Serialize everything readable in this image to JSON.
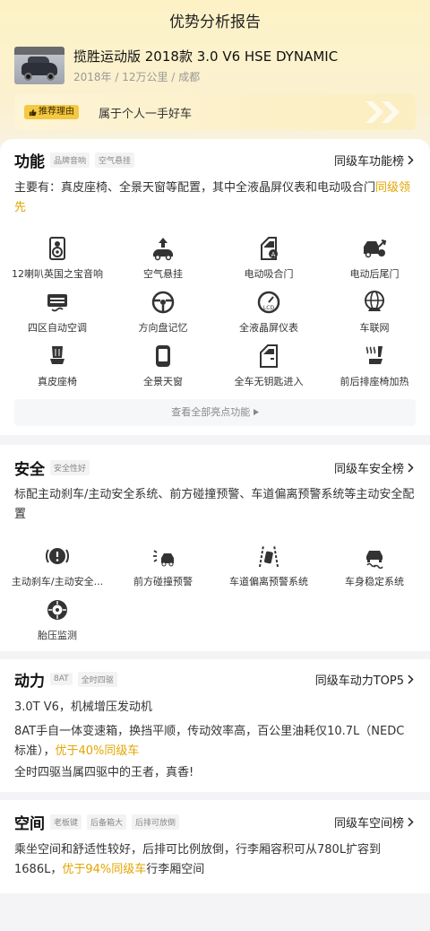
{
  "header": {
    "title": "优势分析报告"
  },
  "car": {
    "thumb_text": "揽胜运动版",
    "name": "揽胜运动版 2018款 3.0 V6 HSE DYNAMIC",
    "meta": "2018年 / 12万公里 / 成都"
  },
  "reason": {
    "tag": "推荐理由",
    "text": "属于个人一手好车"
  },
  "function": {
    "title": "功能",
    "tags": [
      "品牌音响",
      "空气悬挂"
    ],
    "link": "同级车功能榜",
    "desc_prefix": "主要有：真皮座椅、全景天窗等配置，其中全液晶屏仪表和电动吸合门",
    "desc_hl": "同级领先",
    "features": [
      {
        "label": "12喇叭英国之宝音响",
        "icon": "speaker-icon"
      },
      {
        "label": "空气悬挂",
        "icon": "air-suspension-icon"
      },
      {
        "label": "电动吸合门",
        "icon": "soft-close-door-icon"
      },
      {
        "label": "电动后尾门",
        "icon": "power-tailgate-icon"
      },
      {
        "label": "四区自动空调",
        "icon": "climate-control-icon"
      },
      {
        "label": "方向盘记忆",
        "icon": "steering-wheel-icon"
      },
      {
        "label": "全液晶屏仪表",
        "icon": "lcd-gauge-icon"
      },
      {
        "label": "车联网",
        "icon": "connected-car-icon"
      },
      {
        "label": "真皮座椅",
        "icon": "leather-seat-icon"
      },
      {
        "label": "全景天窗",
        "icon": "panoramic-roof-icon"
      },
      {
        "label": "全车无钥匙进入",
        "icon": "keyless-entry-icon"
      },
      {
        "label": "前后排座椅加热",
        "icon": "seat-heating-icon"
      }
    ],
    "more": "查看全部亮点功能"
  },
  "safety": {
    "title": "安全",
    "tags": [
      "安全性好"
    ],
    "link": "同级车安全榜",
    "desc": "标配主动刹车/主动安全系统、前方碰撞预警、车道偏离预警系统等主动安全配置",
    "features": [
      {
        "label": "主动刹车/主动安全...",
        "icon": "auto-brake-icon"
      },
      {
        "label": "前方碰撞预警",
        "icon": "collision-warning-icon"
      },
      {
        "label": "车道偏离预警系统",
        "icon": "lane-departure-icon"
      },
      {
        "label": "车身稳定系统",
        "icon": "stability-control-icon"
      },
      {
        "label": "胎压监测",
        "icon": "tire-pressure-icon"
      }
    ]
  },
  "power": {
    "title": "动力",
    "tags": [
      "8AT",
      "全时四驱"
    ],
    "link": "同级车动力TOP5",
    "line1": "3.0T V6，机械增压发动机",
    "line2_prefix": "8AT手自一体变速箱，换挡平顺，传动效率高，百公里油耗仅10.7L（NEDC标准），",
    "line2_hl": "优于40%同级车",
    "line3": "全时四驱当属四驱中的王者，真香!"
  },
  "space": {
    "title": "空间",
    "tags": [
      "老板键",
      "后备箱大",
      "后排可放倒"
    ],
    "link": "同级车空间榜",
    "desc_prefix": "乘坐空间和舒适性较好，后排可比例放倒，行李厢容积可从780L扩容到1686L，",
    "desc_hl": "优于94%同级车",
    "desc_suffix": "行李厢空间"
  },
  "colors": {
    "accent": "#e3a500",
    "tag_yellow": "#f5c842",
    "hero_bg": "#fdf2c6"
  }
}
